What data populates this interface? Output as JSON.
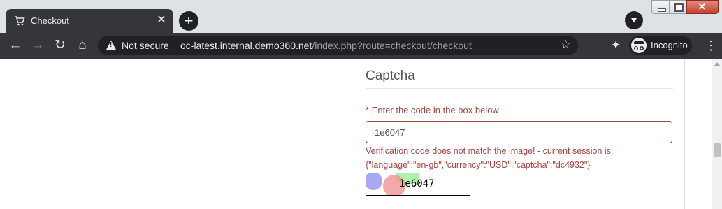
{
  "browser": {
    "tab_title": "Checkout",
    "new_tab_glyph": "+",
    "tab_close_glyph": "✕",
    "security_label": "Not secure",
    "url_host": "oc-latest.internal.demo360.net",
    "url_path": "/index.php?route=checkout/checkout",
    "profile_label": "Incognito",
    "icons": {
      "back": "←",
      "forward": "→",
      "reload": "↻",
      "home": "⌂",
      "star": "☆",
      "extensions": "✦",
      "menu": "⋮"
    }
  },
  "captcha": {
    "section_title": "Captcha",
    "required_marker": "*",
    "field_label": "Enter the code in the box below",
    "input_value": "1e6047",
    "error_message_line1": "Verification code does not match the image! - current session is:",
    "error_message_line2": "{\"language\":\"en-gb\",\"currency\":\"USD\",\"captcha\":\"dc4932\"}",
    "image_text": "1e6047"
  },
  "colors": {
    "error": "#a94442",
    "required": "#e03131",
    "chrome_dark": "#35363a",
    "tab_strip": "#dee1e6"
  }
}
